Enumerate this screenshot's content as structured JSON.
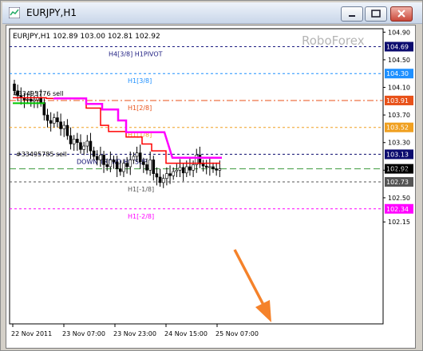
{
  "window": {
    "title": "EURJPY,H1",
    "buttons": {
      "minimize": "minimize",
      "maximize": "maximize",
      "close": "close"
    }
  },
  "chart": {
    "symbol_info": "EURJPY,H1  102.89 103.00 102.81 102.92",
    "watermark": "RoboForex",
    "price_axis": [
      "104.90",
      "104.50",
      "104.10",
      "103.70",
      "103.30",
      "102.90",
      "102.50",
      "102.15"
    ],
    "time_axis": [
      "22 Nov 2011",
      "23 Nov 07:00",
      "23 Nov 23:00",
      "24 Nov 15:00",
      "25 Nov 07:00"
    ],
    "levels": [
      {
        "label": "H4[3/8] H1PIVOT",
        "price": "104.69",
        "line_color": "#1c1c80",
        "box_color": "#0b0b6e",
        "dash": "3,3"
      },
      {
        "label": "H1[3/8]",
        "price": "104.30",
        "line_color": "#1e90ff",
        "box_color": "#1e90ff",
        "dash": "3,3"
      },
      {
        "label": "H1[2/8]",
        "price": "103.91",
        "line_color": "#e8521a",
        "box_color": "#e8521a",
        "dash": "8,3,2,3"
      },
      {
        "label": "H1[1/8]",
        "price": "103.52",
        "line_color": "#f0a020",
        "box_color": "#f0a020",
        "dash": "3,3"
      },
      {
        "label": "DOWN TREND H1 SUP",
        "price": "103.13",
        "line_color": "#0b0b6e",
        "box_color": "#0b0b6e",
        "dash": "3,3"
      },
      {
        "label": "",
        "price": "102.92",
        "line_color": "#3c9a3c",
        "box_color": "#000000",
        "dash": "8,4"
      },
      {
        "label": "H1[-1/8]",
        "price": "102.73",
        "line_color": "#555555",
        "box_color": "#555555",
        "dash": "3,3"
      },
      {
        "label": "H1[-2/8]",
        "price": "102.34",
        "line_color": "#ff00ff",
        "box_color": "#ff00ff",
        "dash": "3,3"
      }
    ],
    "order_labels": [
      {
        "text": "#33495776 sell"
      },
      {
        "text": "#33495785 sell"
      }
    ],
    "arrow_color": "#f5822a"
  }
}
